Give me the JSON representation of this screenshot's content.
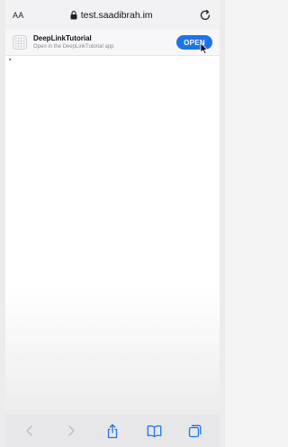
{
  "browser": {
    "text_size_label": "AA",
    "url": "test.saadibrah.im"
  },
  "banner": {
    "app_name": "DeepLinkTutorial",
    "subtitle": "Open in the DeepLinkTutorial app",
    "open_label": "OPEN"
  },
  "colors": {
    "accent": "#1e73e8",
    "toolbar_bg": "#e7e7e9"
  },
  "toolbar": {
    "icons": [
      "back-icon",
      "forward-icon",
      "share-icon",
      "bookmarks-icon",
      "tabs-icon"
    ]
  }
}
